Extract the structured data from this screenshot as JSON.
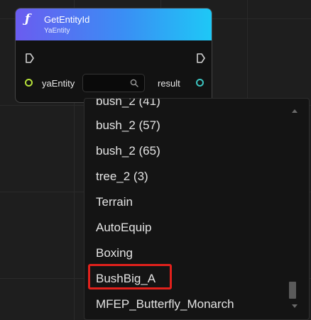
{
  "node": {
    "func_icon": "ƒ",
    "title": "GetEntityId",
    "subtitle": "YaEntity",
    "input_label": "yaEntity",
    "output_label": "result",
    "header_gradient": [
      "#6a5cf0",
      "#1ec8f6"
    ],
    "input_pin_color": "#b6e03a",
    "output_pin_color": "#3cc4c0"
  },
  "dropdown": {
    "options": [
      "bush_2 (57)",
      "bush_2 (65)",
      "tree_2 (3)",
      "Terrain",
      "AutoEquip",
      "Boxing",
      "BushBig_A",
      "MFEP_Butterfly_Monarch"
    ],
    "highlighted_option": "BushBig_A",
    "highlight_color": "#e2211c"
  }
}
